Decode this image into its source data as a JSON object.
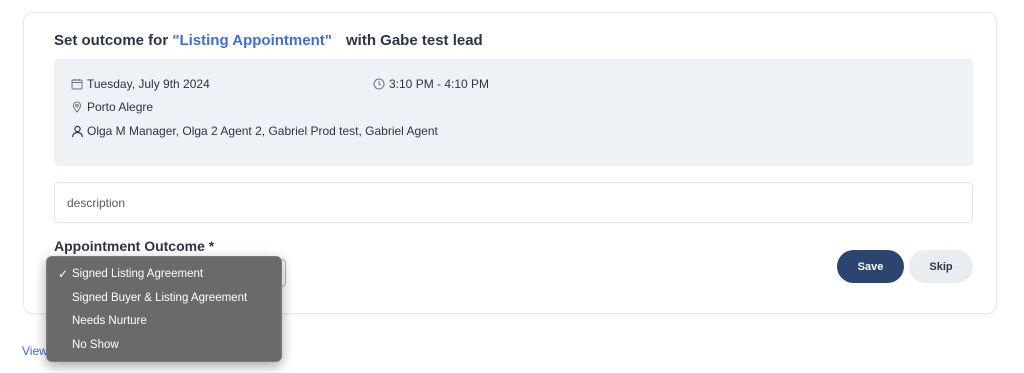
{
  "header": {
    "prefix": "Set outcome for",
    "appointment": "\"Listing Appointment\"",
    "suffix": "with Gabe test lead"
  },
  "details": {
    "date": "Tuesday, July 9th 2024",
    "time": "3:10 PM - 4:10 PM",
    "location": "Porto Alegre",
    "attendees": "Olga M Manager, Olga 2 Agent 2, Gabriel Prod test, Gabriel Agent"
  },
  "description": {
    "placeholder": "description"
  },
  "outcome": {
    "label": "Appointment Outcome *",
    "selected": "Signed Listing Agreement",
    "options": [
      {
        "label": "Signed Listing Agreement",
        "checked": true
      },
      {
        "label": "Signed Buyer & Listing Agreement",
        "checked": false
      },
      {
        "label": "Needs Nurture",
        "checked": false
      },
      {
        "label": "No Show",
        "checked": false
      }
    ]
  },
  "buttons": {
    "save": "Save",
    "skip": "Skip"
  },
  "footer": {
    "view_link": "View"
  },
  "icons": {
    "date": "calendar-icon",
    "time": "clock-icon",
    "location": "map-pin-icon",
    "attendees": "user-icon",
    "check": "checkmark-icon"
  },
  "colors": {
    "accent": "#3f6fd1",
    "primary_button": "#2c4470",
    "details_bg": "#eef1f5",
    "dropdown_bg": "#6a6a6d"
  }
}
